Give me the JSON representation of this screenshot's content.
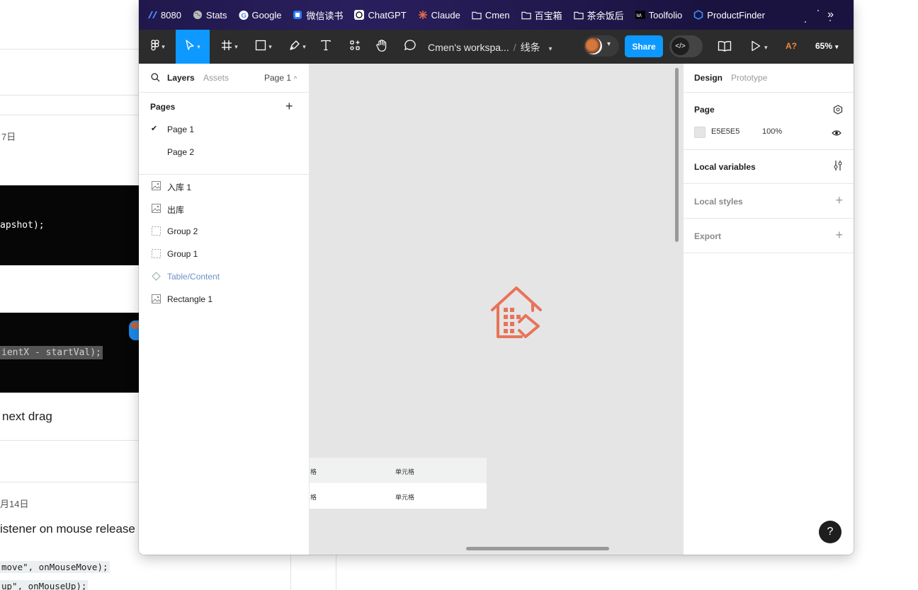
{
  "background_page": {
    "date_top": "7日",
    "code_block_1": "apshot);",
    "code_block_2": "ientX - startVal);",
    "text_next_drag": "next drag",
    "date_bottom": "月14日",
    "text_listener": "istener on mouse release",
    "code_line_1": "move\", onMouseMove);",
    "code_line_2": "up\", onMouseUp);"
  },
  "bookmarks": [
    {
      "label": "8080",
      "icon": "vite-icon"
    },
    {
      "label": "Stats",
      "icon": "globe-icon"
    },
    {
      "label": "Google",
      "icon": "google-icon"
    },
    {
      "label": "微信读书",
      "icon": "weread-icon"
    },
    {
      "label": "ChatGPT",
      "icon": "chatgpt-icon"
    },
    {
      "label": "Claude",
      "icon": "claude-icon"
    },
    {
      "label": "Cmen",
      "icon": "folder-icon"
    },
    {
      "label": "百宝箱",
      "icon": "folder-icon"
    },
    {
      "label": "茶余饭后",
      "icon": "folder-icon"
    },
    {
      "label": "Toolfolio",
      "icon": "toolfolio-icon"
    },
    {
      "label": "ProductFinder",
      "icon": "productfinder-icon"
    }
  ],
  "toolbar": {
    "workspace": "Cmen's workspa...",
    "file_name": "线条",
    "share_label": "Share",
    "a_label": "A?",
    "zoom": "65%"
  },
  "left_panel": {
    "tab_layers": "Layers",
    "tab_assets": "Assets",
    "page_selector": "Page 1",
    "pages_heading": "Pages",
    "pages": [
      {
        "label": "Page 1",
        "selected": true
      },
      {
        "label": "Page 2",
        "selected": false
      }
    ],
    "layers": [
      {
        "label": "入库 1",
        "icon": "image-icon"
      },
      {
        "label": "出库",
        "icon": "image-icon"
      },
      {
        "label": "Group 2",
        "icon": "group-icon"
      },
      {
        "label": "Group 1",
        "icon": "group-icon"
      },
      {
        "label": "Table/Content",
        "icon": "component-instance-icon"
      },
      {
        "label": "Rectangle 1",
        "icon": "image-icon"
      }
    ]
  },
  "canvas": {
    "background_color": "#E5E5E5",
    "icon_color": "#E8735A",
    "table": {
      "header": [
        "格",
        "单元格"
      ],
      "row": [
        "格",
        "单元格"
      ]
    },
    "help_label": "?"
  },
  "right_panel": {
    "tab_design": "Design",
    "tab_prototype": "Prototype",
    "page_heading": "Page",
    "page_color": "E5E5E5",
    "page_opacity": "100%",
    "local_variables": "Local variables",
    "local_styles": "Local styles",
    "export": "Export"
  }
}
